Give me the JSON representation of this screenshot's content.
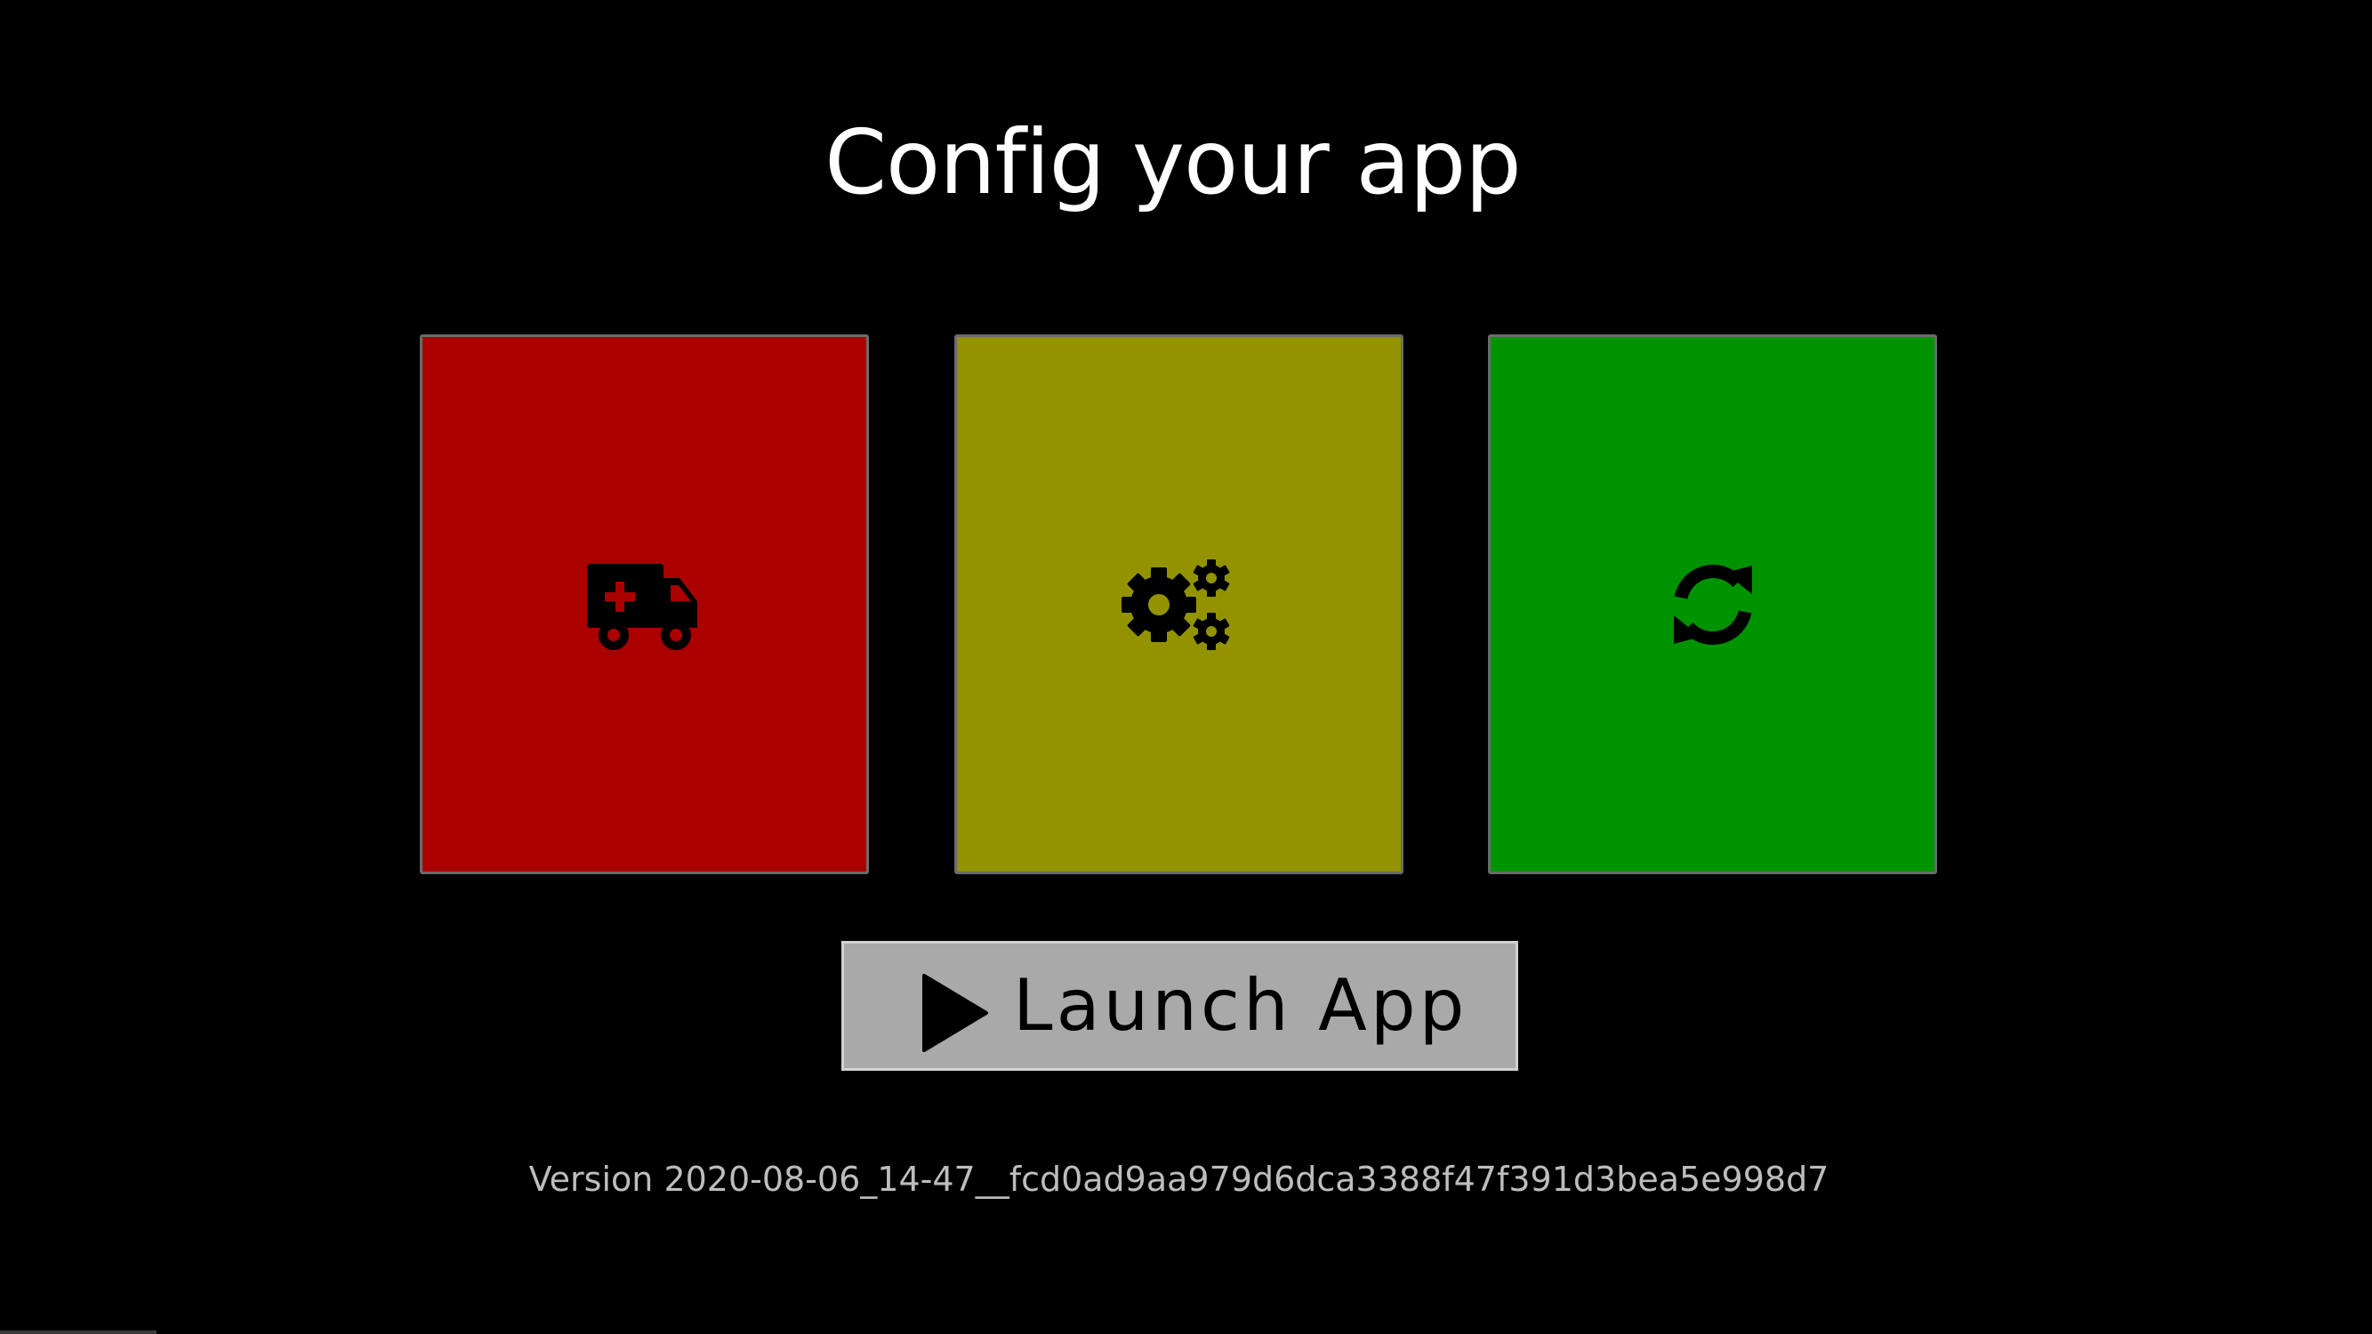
{
  "page": {
    "title": "Config your app",
    "background_color": "#000000"
  },
  "tiles": [
    {
      "name": "emergency-tile",
      "icon": "ambulance-icon",
      "color": "#aa0000"
    },
    {
      "name": "settings-tile",
      "icon": "cogs-icon",
      "color": "#939300"
    },
    {
      "name": "sync-tile",
      "icon": "sync-icon",
      "color": "#009300"
    }
  ],
  "launch_button": {
    "label": "Launch App",
    "icon": "play-icon",
    "color": "#a9a9a9"
  },
  "footer": {
    "version": "Version 2020-08-06_14-47__fcd0ad9aa979d6dca3388f47f391d3bea5e998d7",
    "text_color": "#bdbdbd"
  }
}
